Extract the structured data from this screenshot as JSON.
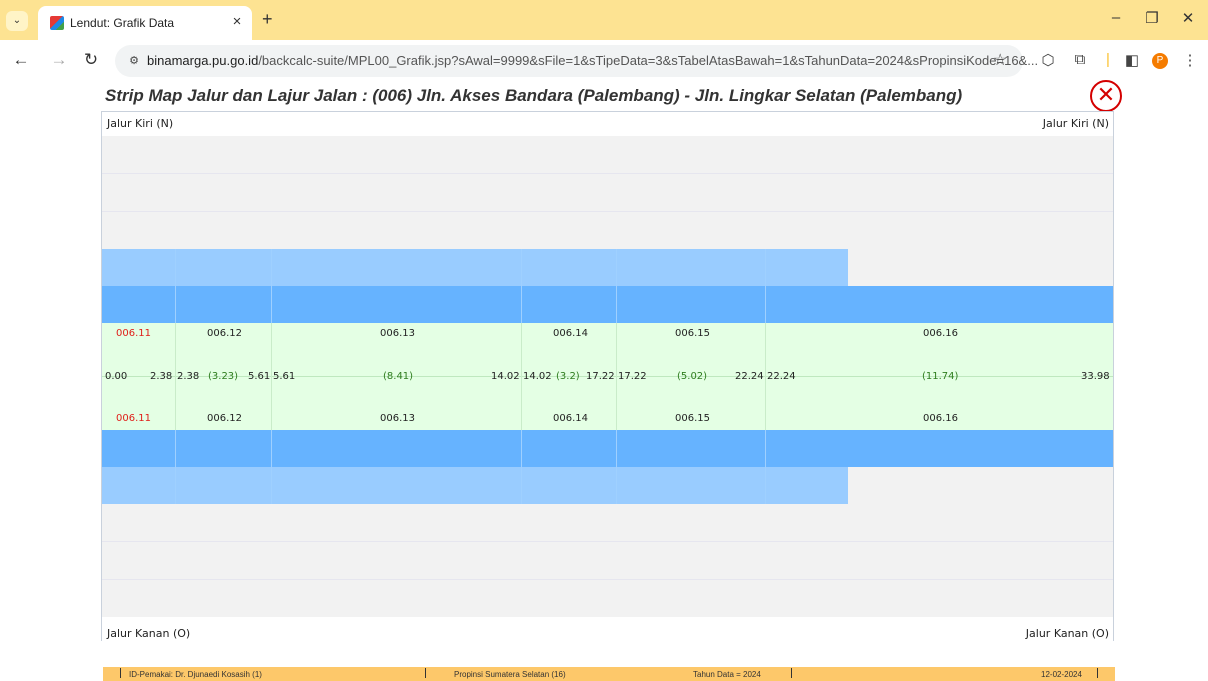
{
  "browser": {
    "tab_title": "Lendut: Grafik Data",
    "url_domain": "binamarga.pu.go.id",
    "url_path": "/backcalc-suite/MPL00_Grafik.jsp?sAwal=9999&sFile=1&sTipeData=3&sTabelAtasBawah=1&sTahunData=2024&sPropinsiKode=16&...",
    "profile_initial": "P"
  },
  "page": {
    "title": "Strip Map Jalur dan Lajur Jalan :  (006) Jln. Akses Bandara (Palembang) - Jln. Lingkar Selatan (Palembang)",
    "label_top_left": "Jalur Kiri (N)",
    "label_top_right": "Jalur Kiri (N)",
    "label_bottom_left": "Jalur Kanan (O)",
    "label_bottom_right": "Jalur Kanan (O)"
  },
  "segments": {
    "codes": [
      "006.11",
      "006.12",
      "006.13",
      "006.14",
      "006.15",
      "006.16"
    ],
    "values": [
      "0.00",
      "2.38",
      "2.38",
      "(3.23)",
      "5.61",
      "5.61",
      "(8.41)",
      "14.02",
      "14.02",
      "(3.2)",
      "17.22",
      "17.22",
      "(5.02)",
      "22.24",
      "22.24",
      "(11.74)",
      "33.98"
    ]
  },
  "colors": {
    "lane_light": "#99ccff",
    "lane_dark": "#66b3ff",
    "median": "#e4ffe4",
    "empty_lane": "#f2f2f2",
    "highlight_code": "#e0201a",
    "length_text": "#2e7d1e"
  },
  "footer": {
    "user": "ID-Pemakai: Dr. Djunaedi Kosasih (1)",
    "province": "Propinsi Sumatera Selatan (16)",
    "year": "Tahun Data = 2024",
    "date": "12-02-2024"
  }
}
